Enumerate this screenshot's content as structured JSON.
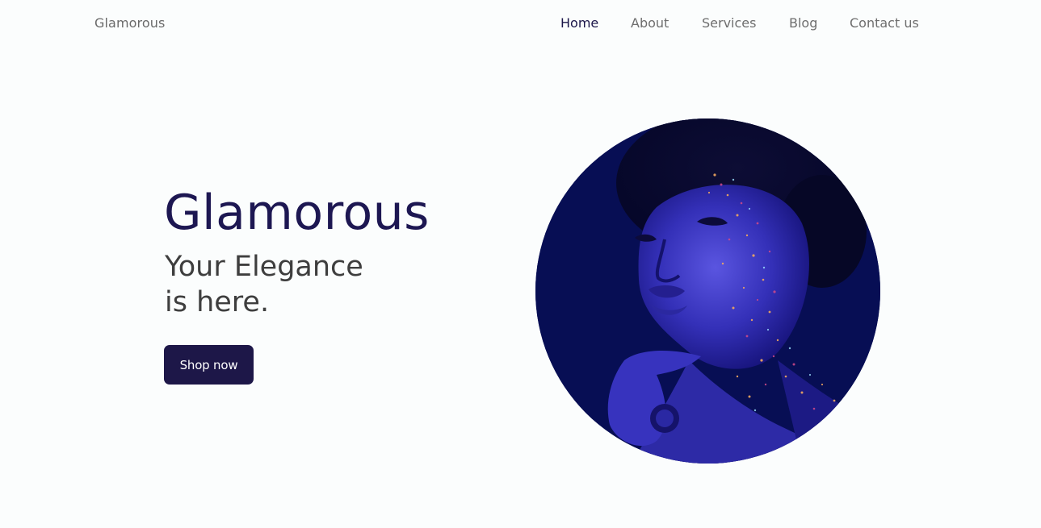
{
  "header": {
    "brand": "Glamorous",
    "nav": [
      {
        "label": "Home",
        "active": true
      },
      {
        "label": "About",
        "active": false
      },
      {
        "label": "Services",
        "active": false
      },
      {
        "label": "Blog",
        "active": false
      },
      {
        "label": "Contact us",
        "active": false
      }
    ]
  },
  "hero": {
    "title": "Glamorous",
    "subtitle_line1": "Your Elegance",
    "subtitle_line2": "is here.",
    "cta_label": "Shop now"
  },
  "colors": {
    "background": "#fbfdfd",
    "primary": "#1d1748",
    "title": "#1d1752",
    "nav_text": "#6e6e6e",
    "portrait_bg": "#070e54"
  },
  "image": {
    "icon": "portrait-photo-icon"
  }
}
